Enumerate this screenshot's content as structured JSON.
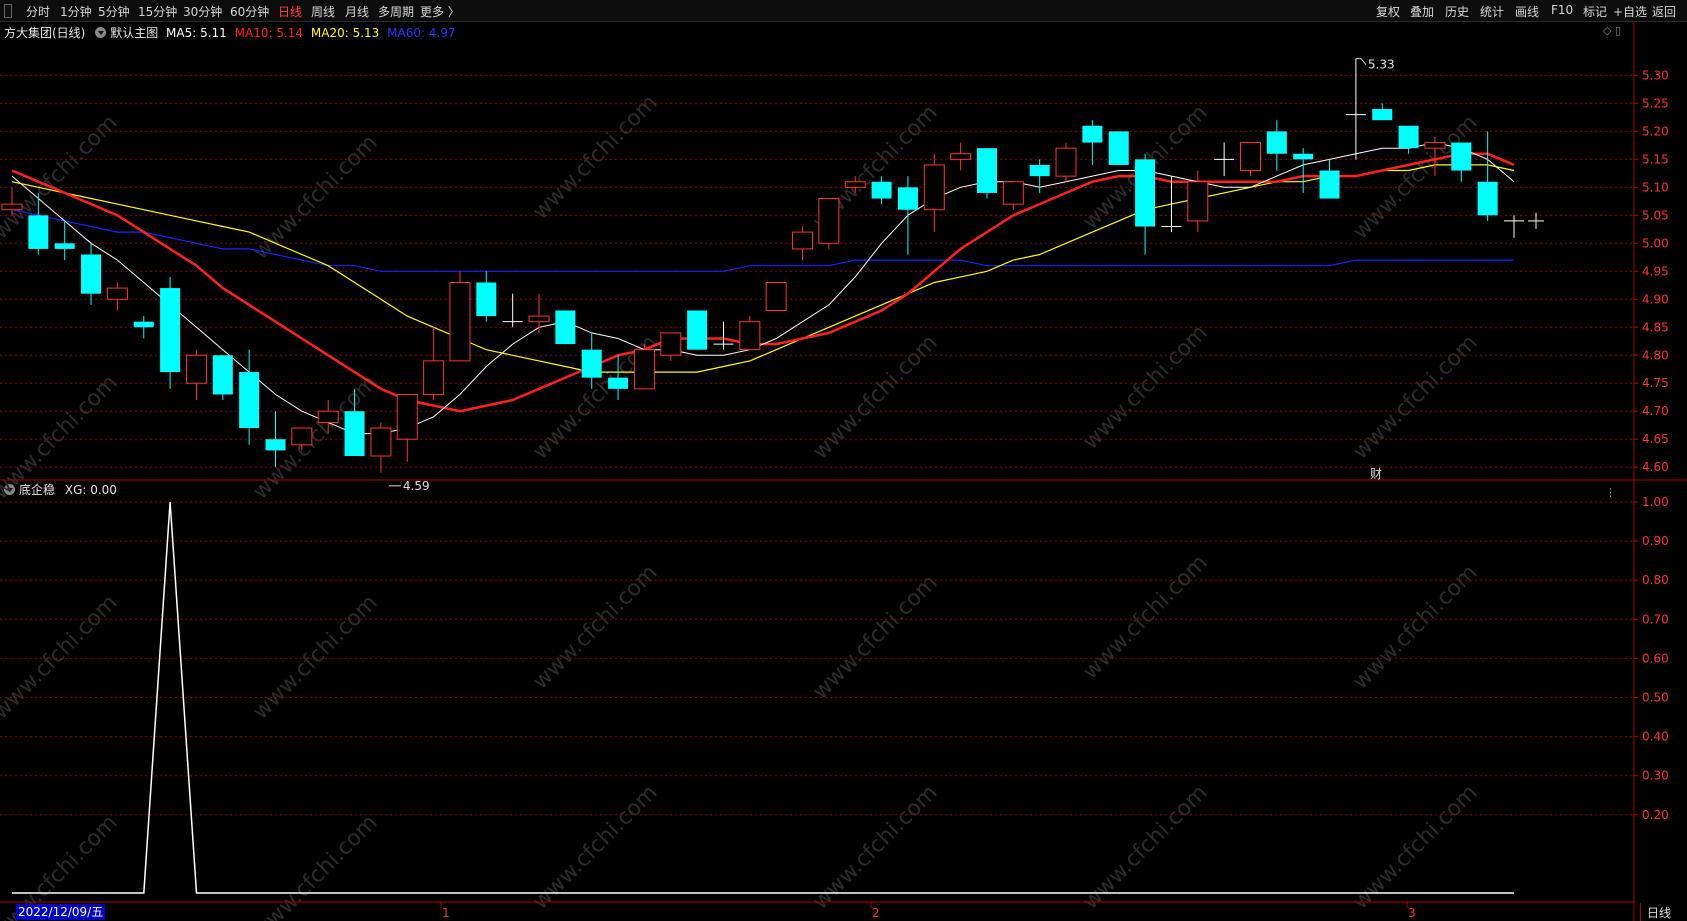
{
  "toolbar": {
    "left": [
      {
        "name": "tab-fenshi",
        "label": "分时"
      },
      {
        "name": "tab-1min",
        "label": "1分钟"
      },
      {
        "name": "tab-5min",
        "label": "5分钟"
      },
      {
        "name": "tab-15min",
        "label": "15分钟"
      },
      {
        "name": "tab-30min",
        "label": "30分钟"
      },
      {
        "name": "tab-60min",
        "label": "60分钟"
      },
      {
        "name": "tab-daily",
        "label": "日线",
        "active": true
      },
      {
        "name": "tab-weekly",
        "label": "周线"
      },
      {
        "name": "tab-monthly",
        "label": "月线"
      },
      {
        "name": "tab-multi",
        "label": "多周期"
      },
      {
        "name": "tab-more",
        "label": "更多 〉"
      }
    ],
    "right": [
      {
        "name": "btn-fuquan",
        "label": "复权"
      },
      {
        "name": "btn-diejia",
        "label": "叠加"
      },
      {
        "name": "btn-lishi",
        "label": "历史"
      },
      {
        "name": "btn-tongji",
        "label": "统计"
      },
      {
        "name": "btn-huaxian",
        "label": "画线"
      },
      {
        "name": "btn-f10",
        "label": "F10"
      },
      {
        "name": "btn-biaoji",
        "label": "标记"
      },
      {
        "name": "btn-zixuan",
        "label": "+自选"
      },
      {
        "name": "btn-fanhui",
        "label": "返回"
      }
    ]
  },
  "main_legend": {
    "stock": "方大集团(日线)",
    "template": "默认主图",
    "ma5": "MA5: 5.11",
    "ma10": "MA10: 5.14",
    "ma20": "MA20: 5.13",
    "ma60": "MA60: 4.97"
  },
  "sub_legend": {
    "title": "底企稳",
    "xg": "XG: 0.00"
  },
  "annotations": {
    "high": "5.33",
    "low": "4.59",
    "cai": "财"
  },
  "date_badge": "2022/12/09/五",
  "month_marks": [
    "1",
    "2",
    "3"
  ],
  "bottom_tab": "日线",
  "watermark": "www.cfchi.com",
  "colors": {
    "up": "#ff3232",
    "down": "#00ffff",
    "ma5": "#ffffff",
    "ma10": "#ff2020",
    "ma20": "#ffff00",
    "ma60": "#2020ff",
    "grid": "#8b0000",
    "axis": "#b00000",
    "indicator": "#ffffff"
  },
  "chart_data": [
    {
      "type": "candlestick",
      "title": "方大集团(日线)",
      "y_ticks": [
        "5.30",
        "5.25",
        "5.20",
        "5.15",
        "5.10",
        "5.05",
        "5.00",
        "4.95",
        "4.90",
        "4.85",
        "4.80",
        "4.75",
        "4.70",
        "4.65",
        "4.60"
      ],
      "ylim": [
        4.57,
        5.34
      ],
      "candles": [
        {
          "o": 5.06,
          "h": 5.1,
          "l": 5.05,
          "c": 5.07
        },
        {
          "o": 5.05,
          "h": 5.09,
          "l": 4.98,
          "c": 4.99
        },
        {
          "o": 5.0,
          "h": 5.04,
          "l": 4.97,
          "c": 4.99
        },
        {
          "o": 4.98,
          "h": 5.0,
          "l": 4.89,
          "c": 4.91
        },
        {
          "o": 4.9,
          "h": 4.93,
          "l": 4.88,
          "c": 4.92
        },
        {
          "o": 4.86,
          "h": 4.87,
          "l": 4.83,
          "c": 4.85
        },
        {
          "o": 4.92,
          "h": 4.94,
          "l": 4.74,
          "c": 4.77
        },
        {
          "o": 4.75,
          "h": 4.81,
          "l": 4.72,
          "c": 4.8
        },
        {
          "o": 4.8,
          "h": 4.8,
          "l": 4.72,
          "c": 4.73
        },
        {
          "o": 4.77,
          "h": 4.81,
          "l": 4.64,
          "c": 4.67
        },
        {
          "o": 4.65,
          "h": 4.7,
          "l": 4.6,
          "c": 4.63
        },
        {
          "o": 4.64,
          "h": 4.67,
          "l": 4.63,
          "c": 4.67
        },
        {
          "o": 4.68,
          "h": 4.72,
          "l": 4.66,
          "c": 4.7
        },
        {
          "o": 4.7,
          "h": 4.74,
          "l": 4.62,
          "c": 4.62
        },
        {
          "o": 4.62,
          "h": 4.68,
          "l": 4.59,
          "c": 4.67
        },
        {
          "o": 4.65,
          "h": 4.73,
          "l": 4.61,
          "c": 4.73
        },
        {
          "o": 4.73,
          "h": 4.85,
          "l": 4.72,
          "c": 4.79
        },
        {
          "o": 4.79,
          "h": 4.95,
          "l": 4.79,
          "c": 4.93
        },
        {
          "o": 4.93,
          "h": 4.95,
          "l": 4.86,
          "c": 4.87
        },
        {
          "o": 4.86,
          "h": 4.91,
          "l": 4.85,
          "c": 4.86
        },
        {
          "o": 4.86,
          "h": 4.91,
          "l": 4.84,
          "c": 4.87
        },
        {
          "o": 4.88,
          "h": 4.88,
          "l": 4.82,
          "c": 4.82
        },
        {
          "o": 4.81,
          "h": 4.84,
          "l": 4.74,
          "c": 4.76
        },
        {
          "o": 4.76,
          "h": 4.8,
          "l": 4.72,
          "c": 4.74
        },
        {
          "o": 4.74,
          "h": 4.82,
          "l": 4.74,
          "c": 4.81
        },
        {
          "o": 4.8,
          "h": 4.84,
          "l": 4.79,
          "c": 4.84
        },
        {
          "o": 4.88,
          "h": 4.88,
          "l": 4.81,
          "c": 4.81
        },
        {
          "o": 4.82,
          "h": 4.86,
          "l": 4.81,
          "c": 4.82
        },
        {
          "o": 4.81,
          "h": 4.87,
          "l": 4.81,
          "c": 4.86
        },
        {
          "o": 4.88,
          "h": 4.93,
          "l": 4.88,
          "c": 4.93
        },
        {
          "o": 4.99,
          "h": 5.03,
          "l": 4.97,
          "c": 5.02
        },
        {
          "o": 5.0,
          "h": 5.08,
          "l": 4.99,
          "c": 5.08
        },
        {
          "o": 5.1,
          "h": 5.12,
          "l": 5.09,
          "c": 5.11
        },
        {
          "o": 5.11,
          "h": 5.12,
          "l": 5.07,
          "c": 5.08
        },
        {
          "o": 5.1,
          "h": 5.12,
          "l": 4.98,
          "c": 5.06
        },
        {
          "o": 5.06,
          "h": 5.16,
          "l": 5.02,
          "c": 5.14
        },
        {
          "o": 5.15,
          "h": 5.18,
          "l": 5.13,
          "c": 5.16
        },
        {
          "o": 5.17,
          "h": 5.17,
          "l": 5.08,
          "c": 5.09
        },
        {
          "o": 5.07,
          "h": 5.11,
          "l": 5.06,
          "c": 5.11
        },
        {
          "o": 5.14,
          "h": 5.15,
          "l": 5.09,
          "c": 5.12
        },
        {
          "o": 5.12,
          "h": 5.18,
          "l": 5.11,
          "c": 5.17
        },
        {
          "o": 5.21,
          "h": 5.22,
          "l": 5.14,
          "c": 5.18
        },
        {
          "o": 5.2,
          "h": 5.2,
          "l": 5.14,
          "c": 5.14
        },
        {
          "o": 5.15,
          "h": 5.16,
          "l": 4.98,
          "c": 5.03
        },
        {
          "o": 5.03,
          "h": 5.12,
          "l": 5.02,
          "c": 5.03
        },
        {
          "o": 5.04,
          "h": 5.13,
          "l": 5.02,
          "c": 5.11
        },
        {
          "o": 5.15,
          "h": 5.18,
          "l": 5.12,
          "c": 5.15
        },
        {
          "o": 5.13,
          "h": 5.18,
          "l": 5.12,
          "c": 5.18
        },
        {
          "o": 5.2,
          "h": 5.22,
          "l": 5.13,
          "c": 5.16
        },
        {
          "o": 5.16,
          "h": 5.17,
          "l": 5.09,
          "c": 5.15
        },
        {
          "o": 5.13,
          "h": 5.15,
          "l": 5.08,
          "c": 5.08
        },
        {
          "o": 5.23,
          "h": 5.33,
          "l": 5.15,
          "c": 5.23
        },
        {
          "o": 5.24,
          "h": 5.25,
          "l": 5.22,
          "c": 5.22
        },
        {
          "o": 5.21,
          "h": 5.21,
          "l": 5.16,
          "c": 5.17
        },
        {
          "o": 5.17,
          "h": 5.19,
          "l": 5.12,
          "c": 5.18
        },
        {
          "o": 5.18,
          "h": 5.18,
          "l": 5.11,
          "c": 5.13
        },
        {
          "o": 5.11,
          "h": 5.2,
          "l": 5.04,
          "c": 5.05
        },
        {
          "o": 5.04,
          "h": 5.05,
          "l": 5.01,
          "c": 5.04
        }
      ],
      "series": [
        {
          "name": "MA5",
          "values": [
            5.12,
            5.08,
            5.04,
            5.0,
            4.97,
            4.93,
            4.89,
            4.85,
            4.81,
            4.77,
            4.73,
            4.7,
            4.68,
            4.66,
            4.66,
            4.67,
            4.69,
            4.73,
            4.78,
            4.82,
            4.85,
            4.86,
            4.84,
            4.83,
            4.81,
            4.81,
            4.8,
            4.8,
            4.81,
            4.83,
            4.86,
            4.89,
            4.94,
            5.0,
            5.05,
            5.08,
            5.1,
            5.11,
            5.11,
            5.1,
            5.11,
            5.12,
            5.13,
            5.13,
            5.12,
            5.11,
            5.1,
            5.1,
            5.12,
            5.14,
            5.15,
            5.16,
            5.17,
            5.17,
            5.18,
            5.17,
            5.15,
            5.11
          ]
        },
        {
          "name": "MA10",
          "values": [
            5.13,
            5.11,
            5.09,
            5.07,
            5.05,
            5.02,
            4.99,
            4.96,
            4.92,
            4.89,
            4.86,
            4.83,
            4.8,
            4.77,
            4.74,
            4.72,
            4.71,
            4.7,
            4.71,
            4.72,
            4.74,
            4.76,
            4.78,
            4.8,
            4.81,
            4.83,
            4.83,
            4.83,
            4.82,
            4.82,
            4.83,
            4.84,
            4.86,
            4.88,
            4.91,
            4.95,
            4.99,
            5.02,
            5.05,
            5.07,
            5.09,
            5.11,
            5.12,
            5.12,
            5.11,
            5.11,
            5.11,
            5.11,
            5.11,
            5.12,
            5.12,
            5.12,
            5.13,
            5.14,
            5.15,
            5.16,
            5.16,
            5.14
          ]
        },
        {
          "name": "MA20",
          "values": [
            5.11,
            5.1,
            5.09,
            5.08,
            5.07,
            5.06,
            5.05,
            5.04,
            5.03,
            5.02,
            5.0,
            4.98,
            4.96,
            4.93,
            4.9,
            4.87,
            4.85,
            4.83,
            4.81,
            4.8,
            4.79,
            4.78,
            4.77,
            4.77,
            4.77,
            4.77,
            4.77,
            4.78,
            4.79,
            4.81,
            4.83,
            4.85,
            4.87,
            4.89,
            4.91,
            4.93,
            4.94,
            4.95,
            4.97,
            4.98,
            5.0,
            5.02,
            5.04,
            5.06,
            5.07,
            5.08,
            5.09,
            5.1,
            5.11,
            5.11,
            5.12,
            5.12,
            5.13,
            5.13,
            5.14,
            5.14,
            5.14,
            5.13
          ]
        },
        {
          "name": "MA60",
          "values": [
            5.06,
            5.05,
            5.04,
            5.03,
            5.02,
            5.02,
            5.01,
            5.0,
            4.99,
            4.99,
            4.98,
            4.97,
            4.96,
            4.96,
            4.95,
            4.95,
            4.95,
            4.95,
            4.95,
            4.95,
            4.95,
            4.95,
            4.95,
            4.95,
            4.95,
            4.95,
            4.95,
            4.95,
            4.96,
            4.96,
            4.96,
            4.96,
            4.97,
            4.97,
            4.97,
            4.97,
            4.97,
            4.96,
            4.96,
            4.96,
            4.96,
            4.96,
            4.96,
            4.96,
            4.96,
            4.96,
            4.96,
            4.96,
            4.96,
            4.96,
            4.96,
            4.97,
            4.97,
            4.97,
            4.97,
            4.97,
            4.97,
            4.97
          ]
        }
      ]
    },
    {
      "type": "line",
      "title": "底企稳",
      "y_ticks": [
        "1.00",
        "0.90",
        "0.80",
        "0.70",
        "0.60",
        "0.50",
        "0.40",
        "0.30",
        "0.20"
      ],
      "ylim": [
        0,
        1
      ],
      "series": [
        {
          "name": "XG",
          "values": [
            0,
            0,
            0,
            0,
            0,
            0,
            1,
            0,
            0,
            0,
            0,
            0,
            0,
            0,
            0,
            0,
            0,
            0,
            0,
            0,
            0,
            0,
            0,
            0,
            0,
            0,
            0,
            0,
            0,
            0,
            0,
            0,
            0,
            0,
            0,
            0,
            0,
            0,
            0,
            0,
            0,
            0,
            0,
            0,
            0,
            0,
            0,
            0,
            0,
            0,
            0,
            0,
            0,
            0,
            0,
            0,
            0,
            0
          ]
        }
      ]
    }
  ]
}
